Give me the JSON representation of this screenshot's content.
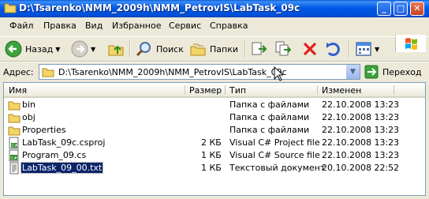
{
  "window": {
    "title": "D:\\Tsarenko\\NMM_2009h\\NMM_PetrovIS\\LabTask_09c",
    "btn_min": "_",
    "btn_max": "□",
    "btn_close": "✕"
  },
  "menu": [
    "Файл",
    "Правка",
    "Вид",
    "Избранное",
    "Сервис",
    "Справка"
  ],
  "toolbar": {
    "back_label": "Назад",
    "search_label": "Поиск",
    "folders_label": "Папки"
  },
  "address": {
    "label": "Адрес:",
    "value": "D:\\Tsarenko\\NMM_2009h\\NMM_PetrovIS\\LabTask_09c",
    "go_label": "Переход"
  },
  "list": {
    "columns": [
      "Имя",
      "Размер",
      "Тип",
      "Изменен"
    ],
    "rows": [
      {
        "name": "bin",
        "size": "",
        "type": "Папка с файлами",
        "modified": "22.10.2008 13:23",
        "icon": "folder-icon"
      },
      {
        "name": "obj",
        "size": "",
        "type": "Папка с файлами",
        "modified": "22.10.2008 13:23",
        "icon": "folder-icon"
      },
      {
        "name": "Properties",
        "size": "",
        "type": "Папка с файлами",
        "modified": "22.10.2008 13:23",
        "icon": "folder-icon"
      },
      {
        "name": "LabTask_09c.csproj",
        "size": "2 КБ",
        "type": "Visual C# Project file",
        "modified": "22.10.2008 13:23",
        "icon": "csproj-icon"
      },
      {
        "name": "Program_09.cs",
        "size": "1 КБ",
        "type": "Visual C# Source file",
        "modified": "22.10.2008 13:23",
        "icon": "cs-file-icon"
      },
      {
        "name": "LabTask_09_00.txt",
        "size": "1 КБ",
        "type": "Текстовый документ",
        "modified": "20.10.2008 22:52",
        "icon": "txt-file-icon"
      }
    ]
  }
}
